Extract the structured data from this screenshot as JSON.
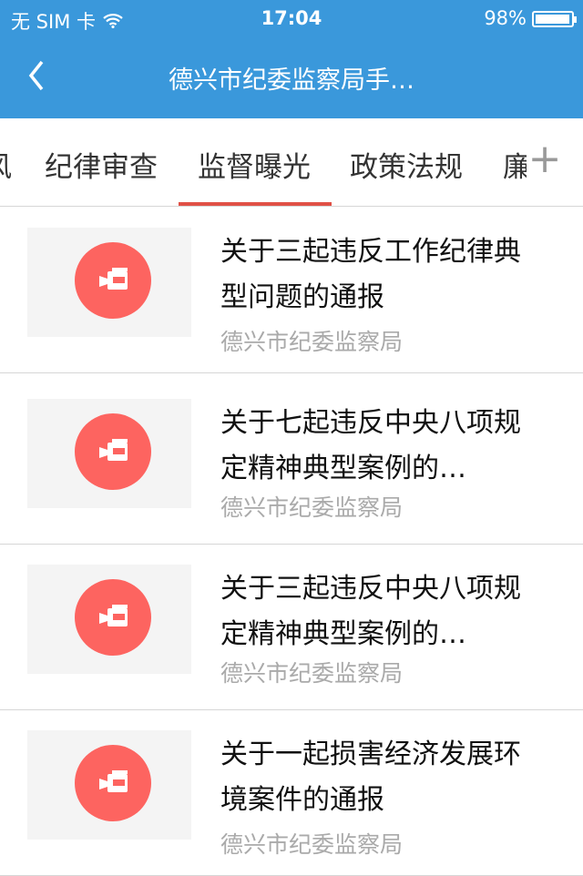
{
  "status_bar": {
    "carrier": "无 SIM 卡",
    "time": "17:04",
    "battery": "98%",
    "battery_level": 0.98
  },
  "header": {
    "title": "德兴市纪委监察局手…"
  },
  "tabs": {
    "items": [
      "风",
      "纪律审查",
      "监督曝光",
      "政策法规",
      "廉"
    ],
    "active": "监督曝光",
    "add_label": "+"
  },
  "articles": [
    {
      "title": "关于三起违反工作纪律典型问题的通报",
      "source": "德兴市纪委监察局",
      "icon": "video-camera-icon"
    },
    {
      "title": "关于七起违反中央八项规定精神典型案例的…",
      "source": "德兴市纪委监察局",
      "icon": "video-camera-icon"
    },
    {
      "title": "关于三起违反中央八项规定精神典型案例的…",
      "source": "德兴市纪委监察局",
      "icon": "video-camera-icon"
    },
    {
      "title": "关于一起损害经济发展环境案件的通报",
      "source": "德兴市纪委监察局",
      "icon": "video-camera-icon"
    }
  ],
  "colors": {
    "header": "#3a98db",
    "accent": "#e05046",
    "icon_circle": "#fd6460"
  }
}
